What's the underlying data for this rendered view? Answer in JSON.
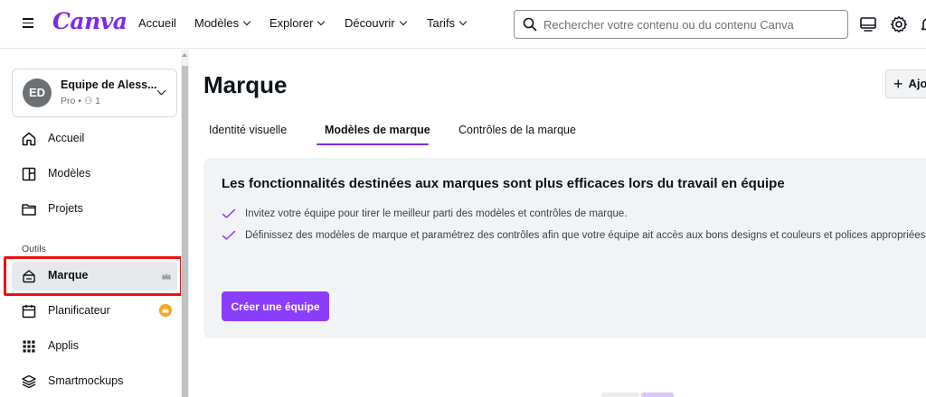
{
  "header": {
    "logo": "Canva",
    "nav": [
      {
        "label": "Accueil",
        "dropdown": false
      },
      {
        "label": "Modèles",
        "dropdown": true
      },
      {
        "label": "Explorer",
        "dropdown": true
      },
      {
        "label": "Découvrir",
        "dropdown": true
      },
      {
        "label": "Tarifs",
        "dropdown": true
      }
    ],
    "search": {
      "placeholder": "Rechercher votre contenu ou du contenu Canva",
      "value": ""
    },
    "icons": [
      "desktop-icon",
      "gear-icon",
      "bell-icon"
    ]
  },
  "sidebar": {
    "team": {
      "initials": "ED",
      "name": "Equipe de Aless...",
      "plan": "Pro • ⚇ 1"
    },
    "items": [
      {
        "label": "Accueil",
        "icon": "home-icon"
      },
      {
        "label": "Modèles",
        "icon": "templates-icon"
      },
      {
        "label": "Projets",
        "icon": "folder-icon"
      }
    ],
    "section_label": "Outils",
    "tools": [
      {
        "label": "Marque",
        "icon": "brand-icon",
        "badge": "crown",
        "active": true
      },
      {
        "label": "Planificateur",
        "icon": "calendar-icon",
        "badge": "crown-orange",
        "active": false
      },
      {
        "label": "Applis",
        "icon": "apps-icon",
        "badge": "",
        "active": false
      },
      {
        "label": "Smartmockups",
        "icon": "layers-icon",
        "badge": "",
        "active": false
      }
    ]
  },
  "main": {
    "title": "Marque",
    "add_label": "Ajo",
    "tabs": [
      {
        "label": "Identité visuelle",
        "active": false
      },
      {
        "label": "Modèles de marque",
        "active": true
      },
      {
        "label": "Contrôles de la marque",
        "active": false
      }
    ],
    "panel": {
      "title": "Les fonctionnalités destinées aux marques sont plus efficaces lors du travail en équipe",
      "bullets": [
        "Invitez votre équipe pour tirer le meilleur parti des modèles et contrôles de marque.",
        "Définissez des modèles de marque et paramétrez des contrôles afin que votre équipe ait accès aux bons designs et couleurs et polices appropriées."
      ],
      "cta": "Créer une équipe"
    }
  },
  "colors": {
    "accent": "#7d2ae8",
    "cta": "#8b3dff",
    "highlight": "#ee1111",
    "crown": "#f5a623"
  }
}
